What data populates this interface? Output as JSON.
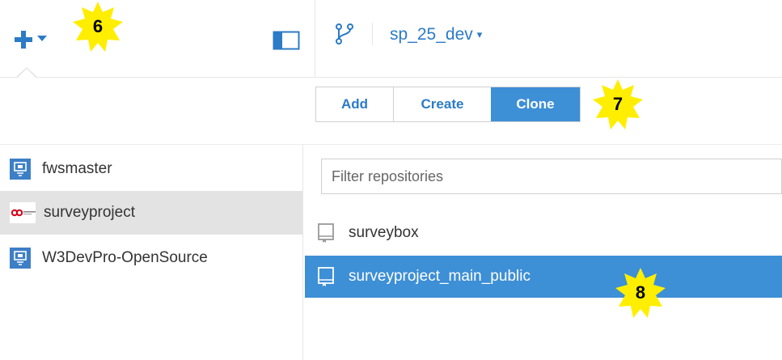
{
  "toolbar": {
    "add_icon": "plus-icon",
    "caret_icon": "caret-down-icon",
    "layout_icon": "sidebar-panel-icon",
    "branch_icon": "branch-icon",
    "branch_name": "sp_25_dev",
    "branch_caret": "▾"
  },
  "segments": [
    {
      "label": "Add",
      "active": false
    },
    {
      "label": "Create",
      "active": false
    },
    {
      "label": "Clone",
      "active": true
    }
  ],
  "callouts": [
    "6",
    "7",
    "8"
  ],
  "accounts": [
    {
      "label": "fwsmaster",
      "icon": "server-account-icon",
      "selected": false
    },
    {
      "label": "surveyproject",
      "icon": "surveyproject-logo",
      "selected": true
    },
    {
      "label": "W3DevPro-OpenSource",
      "icon": "server-account-icon",
      "selected": false
    }
  ],
  "filter": {
    "placeholder": "Filter repositories",
    "value": ""
  },
  "repositories": [
    {
      "label": "surveybox",
      "icon": "repository-icon",
      "selected": false
    },
    {
      "label": "surveyproject_main_public",
      "icon": "repository-icon",
      "selected": true
    }
  ],
  "colors": {
    "accent": "#3d8fd6",
    "link": "#2b7bc6",
    "callout": "#ffee00"
  }
}
